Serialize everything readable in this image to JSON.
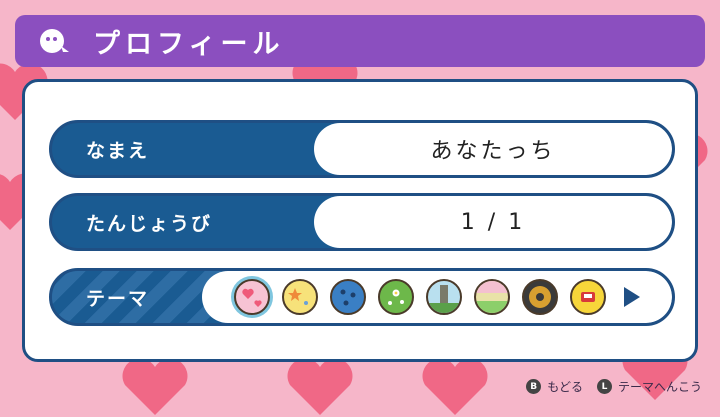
{
  "header": {
    "title": "プロフィール",
    "icon": "tamagotchi-icon"
  },
  "profile": {
    "name_label": "なまえ",
    "name_value": "あなたっち",
    "birthday_label": "たんじょうび",
    "birthday_value": "1 / 1",
    "theme_label": "テーマ"
  },
  "themes": [
    {
      "icon": "hearts-theme",
      "selected": true
    },
    {
      "icon": "stars-theme"
    },
    {
      "icon": "dots-theme"
    },
    {
      "icon": "flowers-theme"
    },
    {
      "icon": "forest-theme"
    },
    {
      "icon": "meadow-theme"
    },
    {
      "icon": "space-theme"
    },
    {
      "icon": "toy-theme"
    }
  ],
  "footer": {
    "back_key": "B",
    "back_label": "もどる",
    "theme_key": "L",
    "theme_label": "テーマへんこう"
  },
  "colors": {
    "background": "#f6b6c9",
    "header": "#8b4fbf",
    "navy": "#1a5b92",
    "hearts": "#ef5a7a"
  }
}
